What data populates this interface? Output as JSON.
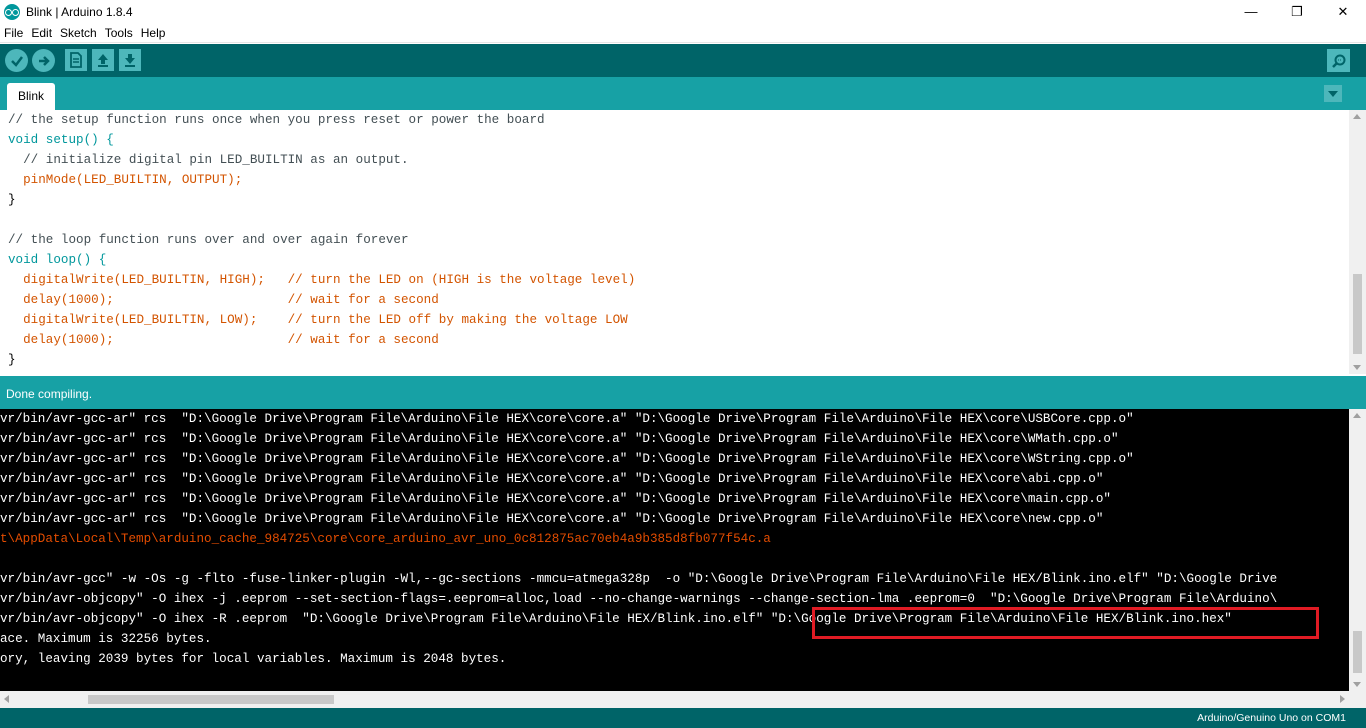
{
  "window": {
    "title": "Blink | Arduino 1.8.4",
    "minimize_glyph": "—",
    "maximize_glyph": "❐",
    "close_glyph": "✕"
  },
  "menu": [
    "File",
    "Edit",
    "Sketch",
    "Tools",
    "Help"
  ],
  "toolbar": {
    "verify_icon": "checkmark-icon",
    "upload_icon": "right-arrow-icon",
    "new_icon": "new-file-icon",
    "open_icon": "open-arrow-up-icon",
    "save_icon": "save-arrow-down-icon",
    "serial_monitor_icon": "magnifier-icon"
  },
  "tabs": [
    {
      "label": "Blink"
    }
  ],
  "editor": {
    "lines": [
      "// the setup function runs once when you press reset or power the board",
      "void setup() {",
      "  // initialize digital pin LED_BUILTIN as an output.",
      "  pinMode(LED_BUILTIN, OUTPUT);",
      "}",
      "",
      "// the loop function runs over and over again forever",
      "void loop() {",
      "  digitalWrite(LED_BUILTIN, HIGH);   // turn the LED on (HIGH is the voltage level)",
      "  delay(1000);                       // wait for a second",
      "  digitalWrite(LED_BUILTIN, LOW);    // turn the LED off by making the voltage LOW",
      "  delay(1000);                       // wait for a second",
      "}"
    ]
  },
  "status": {
    "text": "Done compiling."
  },
  "console": {
    "lines": [
      "vr/bin/avr-gcc-ar\" rcs  \"D:\\Google Drive\\Program File\\Arduino\\File HEX\\core\\core.a\" \"D:\\Google Drive\\Program File\\Arduino\\File HEX\\core\\USBCore.cpp.o\"",
      "vr/bin/avr-gcc-ar\" rcs  \"D:\\Google Drive\\Program File\\Arduino\\File HEX\\core\\core.a\" \"D:\\Google Drive\\Program File\\Arduino\\File HEX\\core\\WMath.cpp.o\"",
      "vr/bin/avr-gcc-ar\" rcs  \"D:\\Google Drive\\Program File\\Arduino\\File HEX\\core\\core.a\" \"D:\\Google Drive\\Program File\\Arduino\\File HEX\\core\\WString.cpp.o\"",
      "vr/bin/avr-gcc-ar\" rcs  \"D:\\Google Drive\\Program File\\Arduino\\File HEX\\core\\core.a\" \"D:\\Google Drive\\Program File\\Arduino\\File HEX\\core\\abi.cpp.o\"",
      "vr/bin/avr-gcc-ar\" rcs  \"D:\\Google Drive\\Program File\\Arduino\\File HEX\\core\\core.a\" \"D:\\Google Drive\\Program File\\Arduino\\File HEX\\core\\main.cpp.o\"",
      "vr/bin/avr-gcc-ar\" rcs  \"D:\\Google Drive\\Program File\\Arduino\\File HEX\\core\\core.a\" \"D:\\Google Drive\\Program File\\Arduino\\File HEX\\core\\new.cpp.o\"",
      "t\\AppData\\Local\\Temp\\arduino_cache_984725\\core\\core_arduino_avr_uno_0c812875ac70eb4a9b385d8fb077f54c.a",
      "",
      "vr/bin/avr-gcc\" -w -Os -g -flto -fuse-linker-plugin -Wl,--gc-sections -mmcu=atmega328p  -o \"D:\\Google Drive\\Program File\\Arduino\\File HEX/Blink.ino.elf\" \"D:\\Google Drive",
      "vr/bin/avr-objcopy\" -O ihex -j .eeprom --set-section-flags=.eeprom=alloc,load --no-change-warnings --change-section-lma .eeprom=0  \"D:\\Google Drive\\Program File\\Arduino\\",
      "vr/bin/avr-objcopy\" -O ihex -R .eeprom  \"D:\\Google Drive\\Program File\\Arduino\\File HEX/Blink.ino.elf\" \"D:\\Google Drive\\Program File\\Arduino\\File HEX/Blink.ino.hex\"",
      "ace. Maximum is 32256 bytes.",
      "ory, leaving 2039 bytes for local variables. Maximum is 2048 bytes."
    ],
    "red_line_index": 6
  },
  "footer": {
    "board": "Arduino/Genuino Uno on COM1"
  },
  "colors": {
    "toolbar": "#006468",
    "tabrow": "#17a1a5",
    "highlight": "#e01b24",
    "console_error": "#e34c00"
  }
}
